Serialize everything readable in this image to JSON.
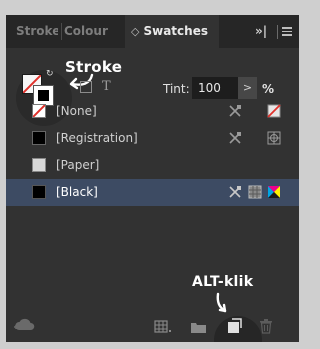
{
  "tabs": [
    {
      "label": "Stroke"
    },
    {
      "label": "Colour"
    },
    {
      "label": "Swatches",
      "prefix": "◇",
      "active": true
    }
  ],
  "collapse_label": "»|",
  "annotation_stroke": "Stroke",
  "annotation_alt": "ALT-klik",
  "format_text_glyph": "T",
  "tint": {
    "label": "Tint:",
    "value": "100",
    "unit": "%",
    "dropdown": ">"
  },
  "swatches": [
    {
      "name": "[None]",
      "color": "#ffffff",
      "type": "none"
    },
    {
      "name": "[Registration]",
      "color": "#000000",
      "type": "registration"
    },
    {
      "name": "[Paper]",
      "color": "#d9d9d9",
      "type": "paper"
    },
    {
      "name": "[Black]",
      "color": "#000000",
      "type": "black",
      "selected": true
    }
  ],
  "colors": {
    "selection": "#3d4b63",
    "panel": "#323232",
    "tabbar": "#262626"
  }
}
